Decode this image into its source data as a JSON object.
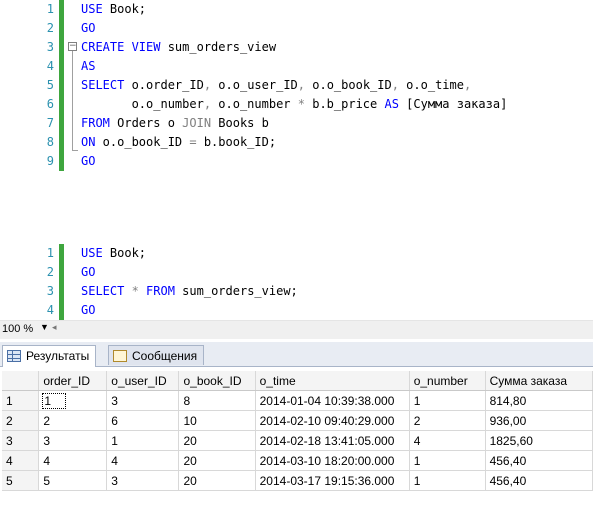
{
  "editor_top": {
    "lines": [
      {
        "n": "1",
        "parts": [
          {
            "t": "USE",
            "c": "kw"
          },
          {
            "t": " Book;",
            "c": ""
          }
        ]
      },
      {
        "n": "2",
        "parts": [
          {
            "t": "GO",
            "c": "kw"
          }
        ]
      },
      {
        "n": "3",
        "parts": [
          {
            "t": "CREATE VIEW",
            "c": "kw"
          },
          {
            "t": " sum_orders_view",
            "c": ""
          }
        ]
      },
      {
        "n": "4",
        "parts": [
          {
            "t": "AS",
            "c": "kw"
          }
        ]
      },
      {
        "n": "5",
        "parts": [
          {
            "t": "SELECT",
            "c": "kw"
          },
          {
            "t": " o.order_ID",
            "c": ""
          },
          {
            "t": ",",
            "c": "gray"
          },
          {
            "t": " o.o_user_ID",
            "c": ""
          },
          {
            "t": ",",
            "c": "gray"
          },
          {
            "t": " o.o_book_ID",
            "c": ""
          },
          {
            "t": ",",
            "c": "gray"
          },
          {
            "t": " o.o_time",
            "c": ""
          },
          {
            "t": ",",
            "c": "gray"
          }
        ]
      },
      {
        "n": "6",
        "parts": [
          {
            "t": "       o.o_number",
            "c": ""
          },
          {
            "t": ",",
            "c": "gray"
          },
          {
            "t": " o.o_number ",
            "c": ""
          },
          {
            "t": "*",
            "c": "gray"
          },
          {
            "t": " b.b_price ",
            "c": ""
          },
          {
            "t": "AS",
            "c": "kw"
          },
          {
            "t": " [Сумма заказа]",
            "c": ""
          }
        ]
      },
      {
        "n": "7",
        "parts": [
          {
            "t": "FROM",
            "c": "kw"
          },
          {
            "t": " Orders o ",
            "c": ""
          },
          {
            "t": "JOIN",
            "c": "gray"
          },
          {
            "t": " Books b",
            "c": ""
          }
        ]
      },
      {
        "n": "8",
        "parts": [
          {
            "t": "ON",
            "c": "kw"
          },
          {
            "t": " o.o_book_ID ",
            "c": ""
          },
          {
            "t": "=",
            "c": "gray"
          },
          {
            "t": " b.book_ID;",
            "c": ""
          }
        ]
      },
      {
        "n": "9",
        "parts": [
          {
            "t": "GO",
            "c": "kw"
          }
        ]
      }
    ]
  },
  "editor_bottom": {
    "lines": [
      {
        "n": "1",
        "parts": [
          {
            "t": "USE",
            "c": "kw"
          },
          {
            "t": " Book;",
            "c": ""
          }
        ]
      },
      {
        "n": "2",
        "parts": [
          {
            "t": "GO",
            "c": "kw"
          }
        ]
      },
      {
        "n": "3",
        "parts": [
          {
            "t": "SELECT",
            "c": "kw"
          },
          {
            "t": " * ",
            "c": "gray"
          },
          {
            "t": "FROM",
            "c": "kw"
          },
          {
            "t": " sum_orders_view;",
            "c": ""
          }
        ]
      },
      {
        "n": "4",
        "parts": [
          {
            "t": "GO",
            "c": "kw"
          }
        ]
      }
    ]
  },
  "zoom": {
    "level": "100 %"
  },
  "tabs": {
    "results": "Результаты",
    "messages": "Сообщения"
  },
  "grid": {
    "headers": [
      "order_ID",
      "o_user_ID",
      "o_book_ID",
      "o_time",
      "o_number",
      "Сумма заказа"
    ],
    "rows": [
      {
        "num": "1",
        "cells": [
          "1",
          "3",
          "8",
          "2014-01-04 10:39:38.000",
          "1",
          "814,80"
        ]
      },
      {
        "num": "2",
        "cells": [
          "2",
          "6",
          "10",
          "2014-02-10 09:40:29.000",
          "2",
          "936,00"
        ]
      },
      {
        "num": "3",
        "cells": [
          "3",
          "1",
          "20",
          "2014-02-18 13:41:05.000",
          "4",
          "1825,60"
        ]
      },
      {
        "num": "4",
        "cells": [
          "4",
          "4",
          "20",
          "2014-03-10 18:20:00.000",
          "1",
          "456,40"
        ]
      },
      {
        "num": "5",
        "cells": [
          "5",
          "3",
          "20",
          "2014-03-17 19:15:36.000",
          "1",
          "456,40"
        ]
      }
    ]
  }
}
